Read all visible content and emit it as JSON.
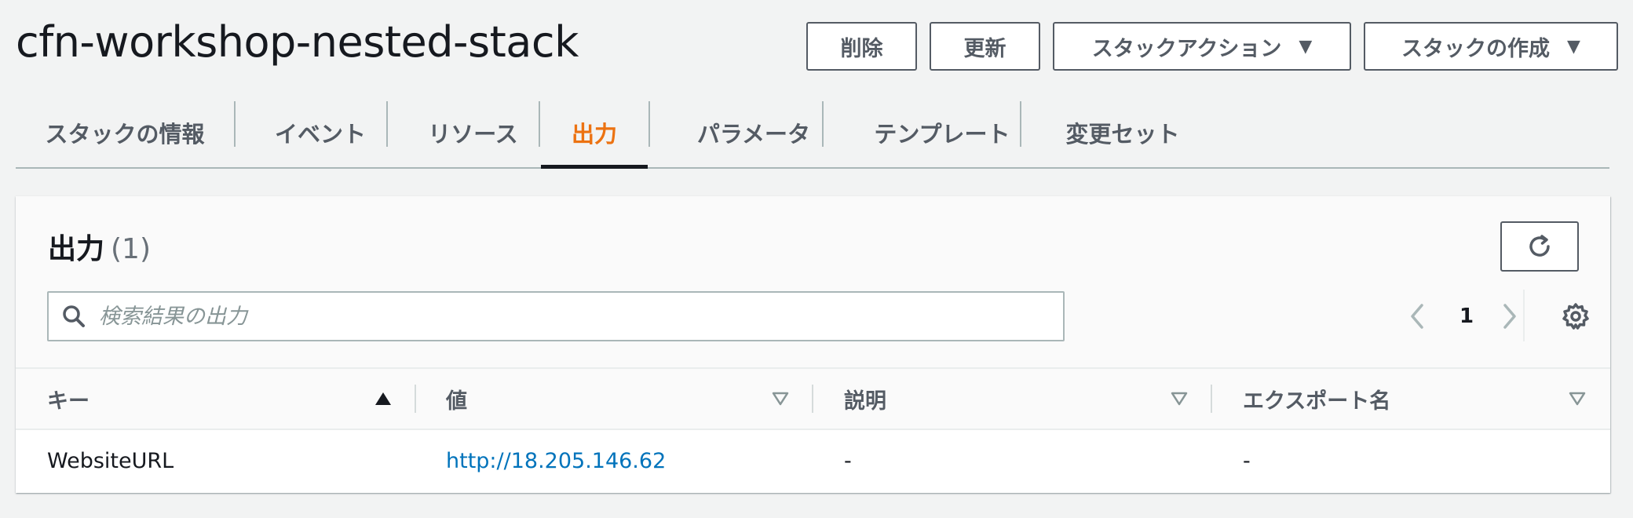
{
  "stack": {
    "name": "cfn-workshop-nested-stack"
  },
  "actions": {
    "delete": "削除",
    "update": "更新",
    "stack_actions": "スタックアクション",
    "create_stack": "スタックの作成"
  },
  "tabs": [
    {
      "label": "スタックの情報",
      "active": false
    },
    {
      "label": "イベント",
      "active": false
    },
    {
      "label": "リソース",
      "active": false
    },
    {
      "label": "出力",
      "active": true
    },
    {
      "label": "パラメータ",
      "active": false
    },
    {
      "label": "テンプレート",
      "active": false
    },
    {
      "label": "変更セット",
      "active": false
    }
  ],
  "outputs": {
    "title": "出力",
    "count": "(1)",
    "search_placeholder": "検索結果の出力",
    "page": "1",
    "columns": [
      "キー",
      "値",
      "説明",
      "エクスポート名"
    ],
    "rows": [
      {
        "key": "WebsiteURL",
        "value": "http://18.205.146.62",
        "description": "-",
        "export_name": "-"
      }
    ]
  },
  "colors": {
    "accent_tab": "#ec7211",
    "link": "#0073bb",
    "text": "#16191f",
    "muted": "#545b64"
  },
  "icons": {
    "search": "search-icon",
    "refresh": "refresh-icon",
    "prev": "chevron-left-icon",
    "next": "chevron-right-icon",
    "settings": "gear-icon",
    "sort_asc": "sort-ascending-icon",
    "sort_none": "sort-descending-outline-icon",
    "caret": "caret-down-icon"
  }
}
